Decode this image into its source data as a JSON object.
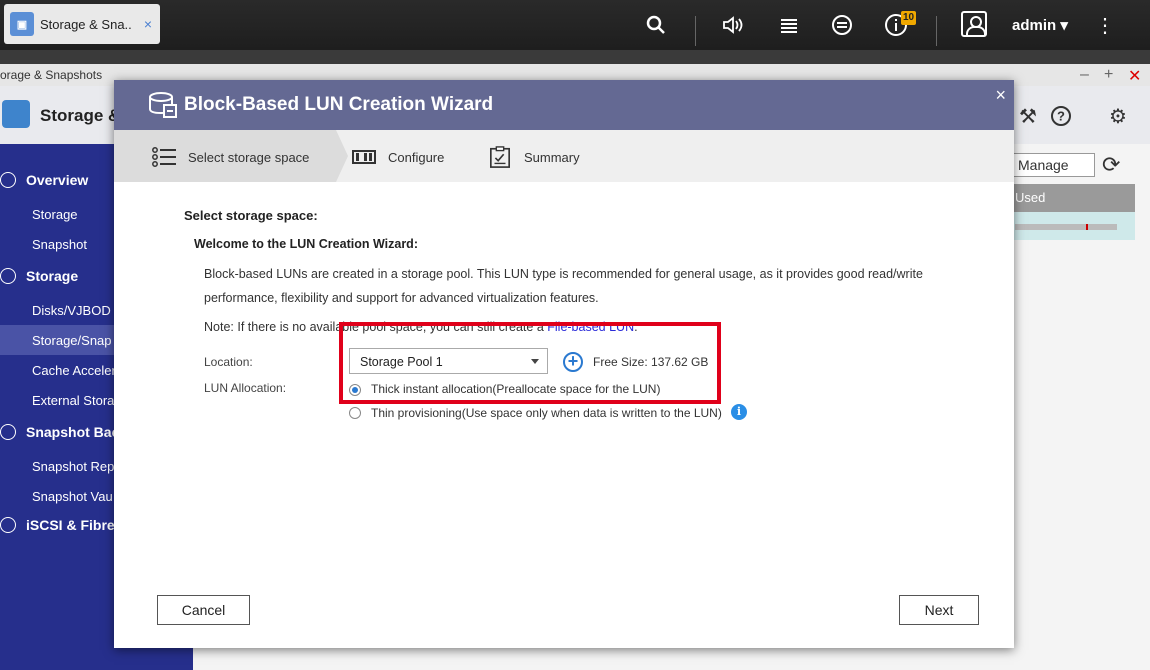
{
  "taskbar": {
    "tab_title": "Storage & Sna...",
    "tab_close": "×",
    "notification_count": "10",
    "user": "admin"
  },
  "app": {
    "window_title": "orage & Snapshots",
    "header_title": "Storage &",
    "sidebar": {
      "items": [
        {
          "label": "Overview"
        },
        {
          "label": "Storage"
        },
        {
          "label": "Snapshot"
        },
        {
          "label": "Storage"
        },
        {
          "label": "Disks/VJBOD"
        },
        {
          "label": "Storage/Snap"
        },
        {
          "label": "Cache Acceler"
        },
        {
          "label": "External Stora"
        },
        {
          "label": "Snapshot Bac"
        },
        {
          "label": "Snapshot Rep"
        },
        {
          "label": "Snapshot Vau"
        },
        {
          "label": "iSCSI & Fibre C"
        }
      ]
    },
    "manage_label": "Manage",
    "table_header": "Used"
  },
  "dialog": {
    "title": "Block-Based LUN Creation Wizard",
    "close": "×",
    "steps": [
      {
        "label": "Select storage space"
      },
      {
        "label": "Configure"
      },
      {
        "label": "Summary"
      }
    ],
    "heading": "Select storage space:",
    "subheading": "Welcome to the LUN Creation Wizard:",
    "description": "Block-based LUNs are created in a storage pool. This LUN type is recommended for general usage, as it provides good read/write performance, flexibility and support for advanced virtualization features.",
    "note_prefix": "Note: If there is no available pool space, you can still create a ",
    "note_link": "File-based LUN",
    "note_suffix": ".",
    "location_label": "Location:",
    "location_value": "Storage Pool 1",
    "free_size": "Free Size: 137.62 GB",
    "allocation_label": "LUN Allocation:",
    "allocation_options": [
      {
        "label": "Thick instant allocation(Preallocate space for the LUN)",
        "selected": true
      },
      {
        "label": "Thin provisioning(Use space only when data is written to the LUN)",
        "selected": false
      }
    ],
    "info_glyph": "i",
    "cancel_label": "Cancel",
    "next_label": "Next"
  },
  "colors": {
    "sidebar": "#262f8c",
    "dialog_title": "#646993",
    "highlight": "#e0001a",
    "accent": "#2a79d0"
  }
}
